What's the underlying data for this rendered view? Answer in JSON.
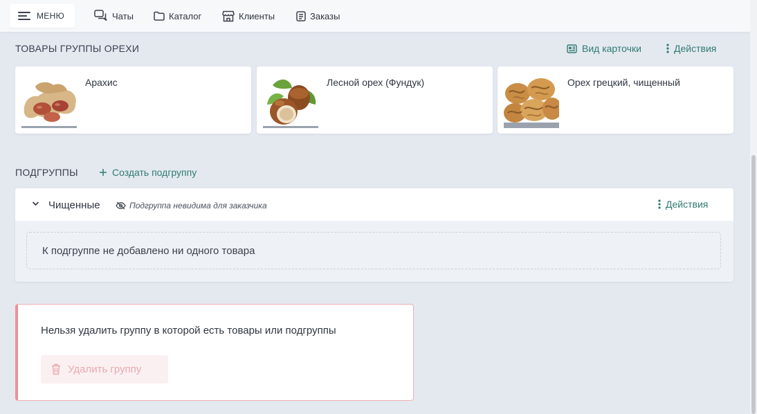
{
  "topbar": {
    "menu_label": "МЕНЮ",
    "nav": [
      {
        "label": "Чаты",
        "icon": "chat-icon"
      },
      {
        "label": "Каталог",
        "icon": "folder-icon"
      },
      {
        "label": "Клиенты",
        "icon": "store-icon"
      },
      {
        "label": "Заказы",
        "icon": "document-icon"
      }
    ]
  },
  "products_section": {
    "title": "ТОВАРЫ ГРУППЫ ОРЕХИ",
    "card_view_label": "Вид карточки",
    "actions_label": "Действия",
    "products": [
      {
        "name": "Арахис"
      },
      {
        "name": "Лесной орех (Фундук)"
      },
      {
        "name": "Орех грецкий, чищенный"
      }
    ]
  },
  "subgroups_section": {
    "title": "ПОДГРУППЫ",
    "create_label": "Создать подгруппу",
    "subgroup": {
      "name": "Чищенные",
      "hidden_note": "Подгруппа невидима для заказчика",
      "actions_label": "Действия",
      "empty_text": "К подгруппе не добавлено ни одного товара"
    }
  },
  "danger_zone": {
    "message": "Нельзя удалить группу в которой есть товары или подгруппы",
    "delete_label": "Удалить группу"
  },
  "colors": {
    "accent": "#2f7a70",
    "background": "#e4e9f0",
    "danger_border": "#ef8f95",
    "disabled_danger_text": "#e7aab0"
  }
}
